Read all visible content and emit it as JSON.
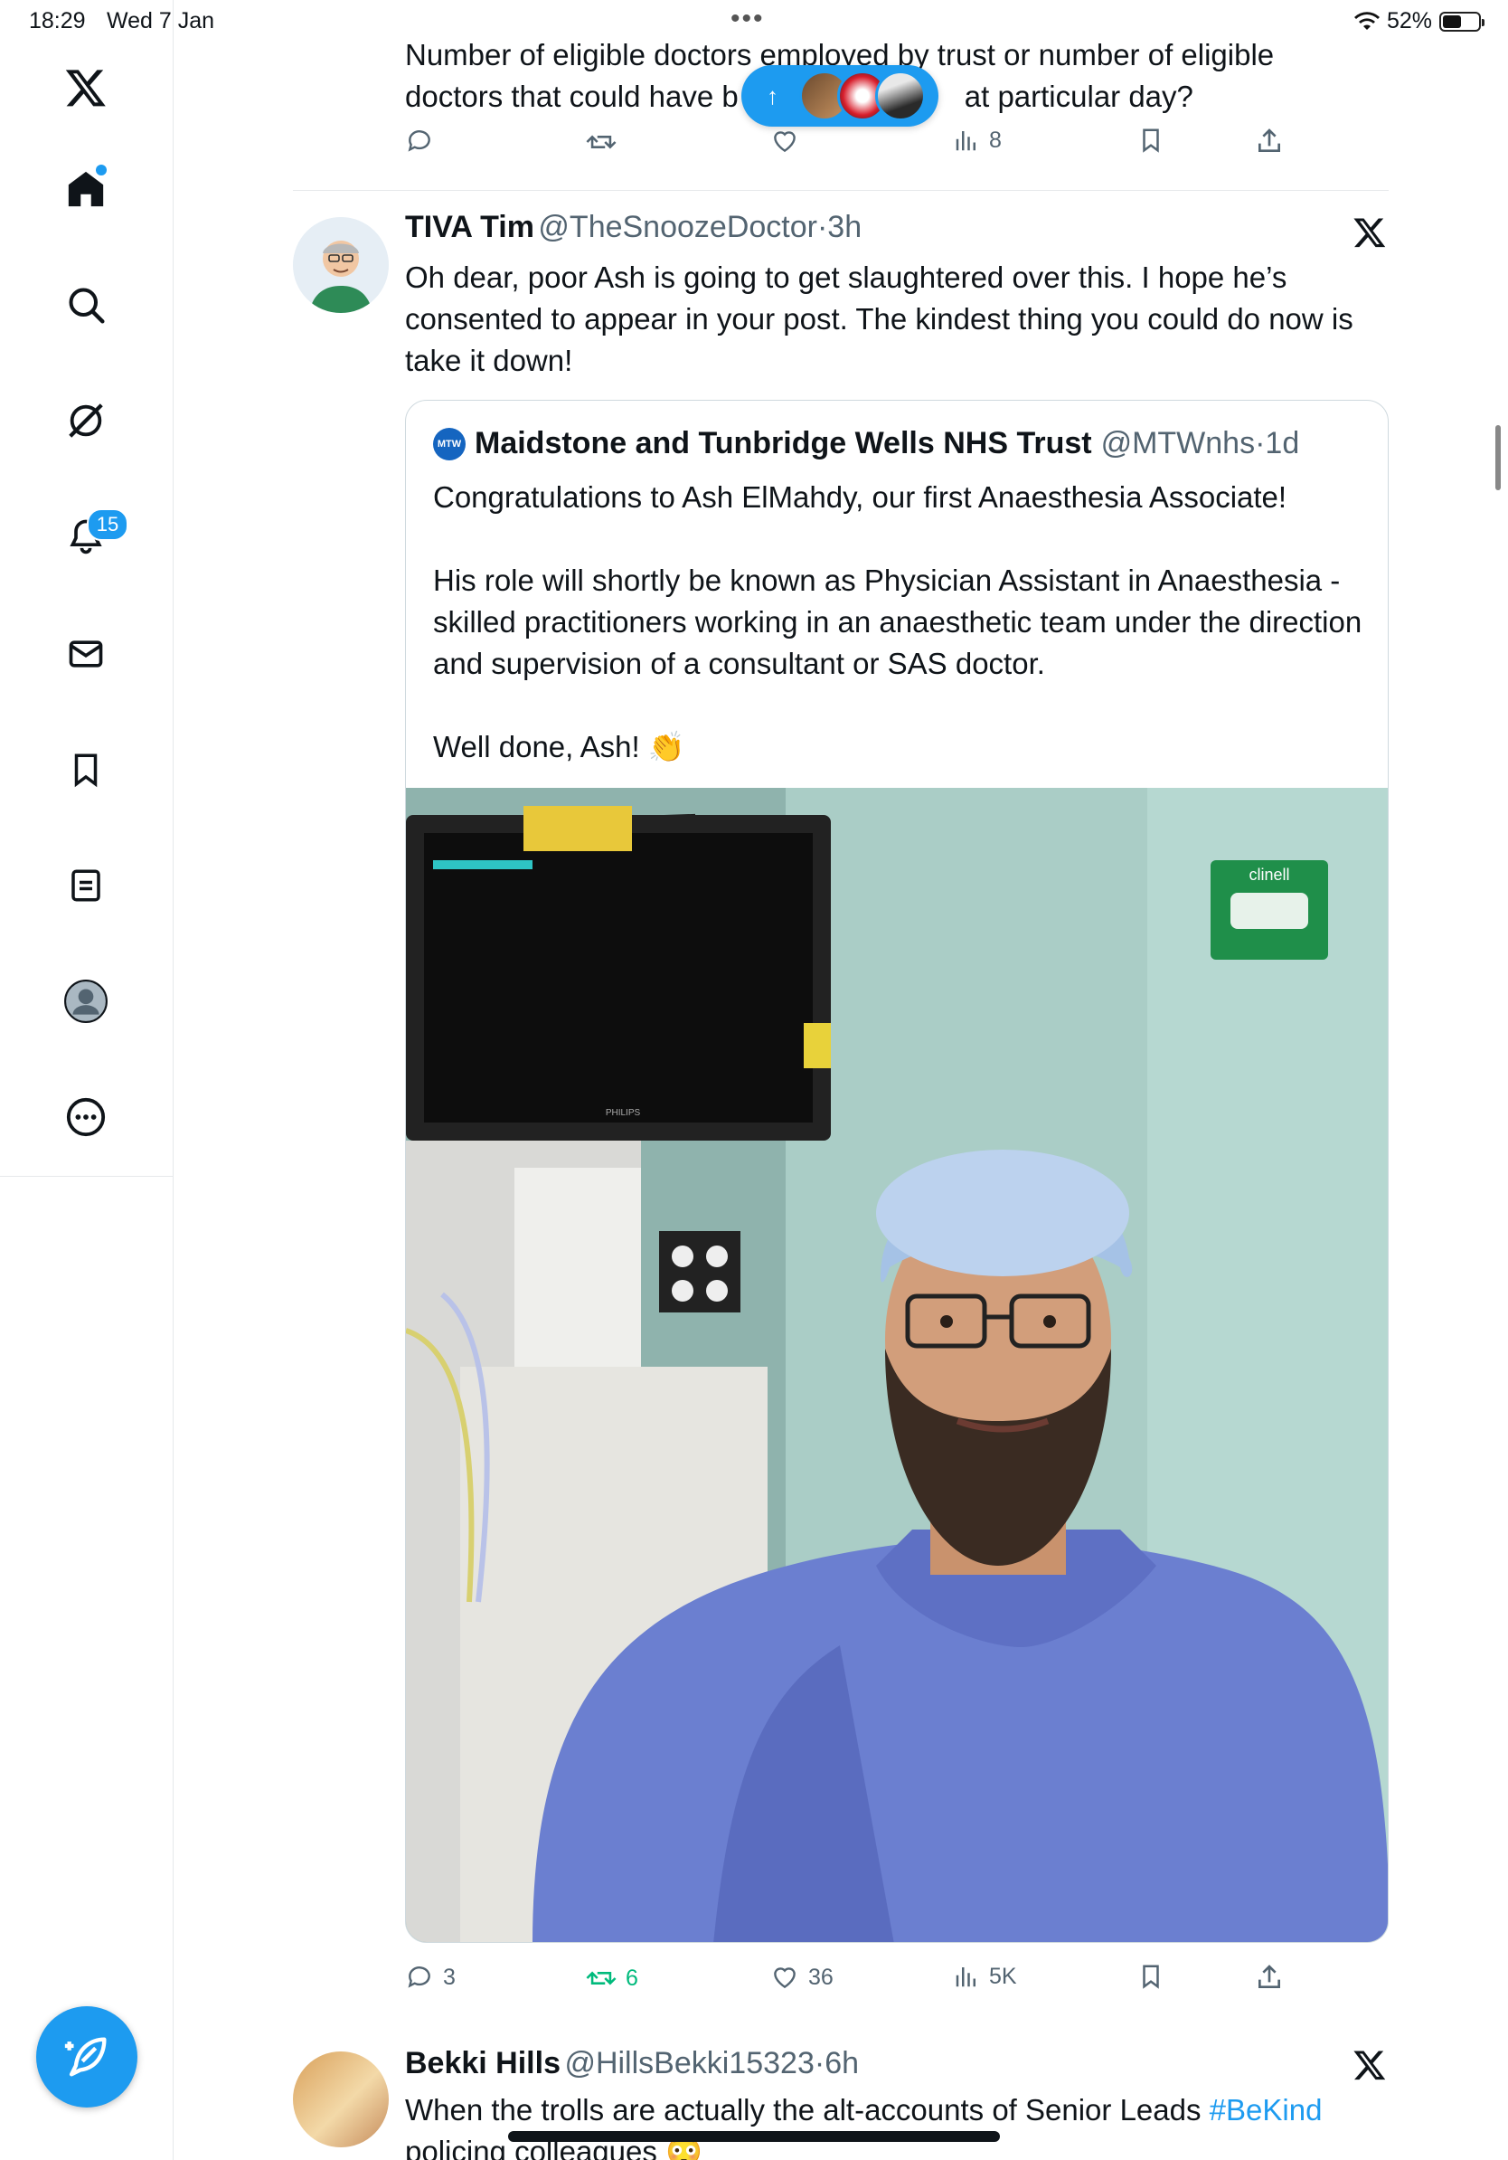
{
  "status_bar": {
    "time": "18:29",
    "date": "Wed 7 Jan",
    "battery": "52%",
    "battery_level": 0.52
  },
  "sidebar": {
    "notifications_badge": "15",
    "accent": "#1d9bf0",
    "icons": [
      "x-logo-icon",
      "home-icon",
      "search-icon",
      "grok-icon",
      "notifications-icon",
      "messages-icon",
      "bookmarks-icon",
      "lists-icon",
      "profile-icon",
      "more-icon",
      "compose-icon"
    ]
  },
  "new_posts_pill": {
    "arrow": "↑"
  },
  "previous_post": {
    "text": "Number of eligible doctors employed by trust or number of eligible doctors that could have been on that particular day?",
    "text_line1": "Number of eligible doctors employed by trust or number of eligible",
    "text_line2_start": "doctors that could have b",
    "text_line2_end": "at particular day?",
    "views": "8"
  },
  "reply_post": {
    "name": "TIVA Tim",
    "handle": "@TheSnoozeDoctor",
    "time": "3h",
    "text": "Oh dear, poor Ash is going to get slaughtered over this. I hope he’s consented to appear in your post. The kindest thing you could do now is take it down!",
    "quote": {
      "badge": "MTW",
      "name": "Maidstone and Tunbridge Wells NHS Trust",
      "handle": "@MTWnhs",
      "time": "1d",
      "para1": "Congratulations to Ash ElMahdy, our first Anaesthesia Associate!",
      "para2": "His role will shortly be known as Physician Assistant in Anaesthesia - skilled practitioners working in an anaesthetic team under the direction and supervision of a consultant or SAS doctor.",
      "para3": "Well done, Ash! 👏",
      "photo_labels": {
        "wipes": "clinell",
        "monitor": "PHILIPS"
      }
    },
    "replies": "3",
    "reposts": "6",
    "likes": "36",
    "views": "5K"
  },
  "next_post": {
    "name": "Bekki Hills",
    "handle": "@HillsBekki15323",
    "time": "6h",
    "text_before": "When the trolls are actually the alt-accounts of Senior Leads",
    "hashtag": "#BeKind",
    "text_line2": "policing colleagues 😳"
  },
  "separator_dot": "·"
}
